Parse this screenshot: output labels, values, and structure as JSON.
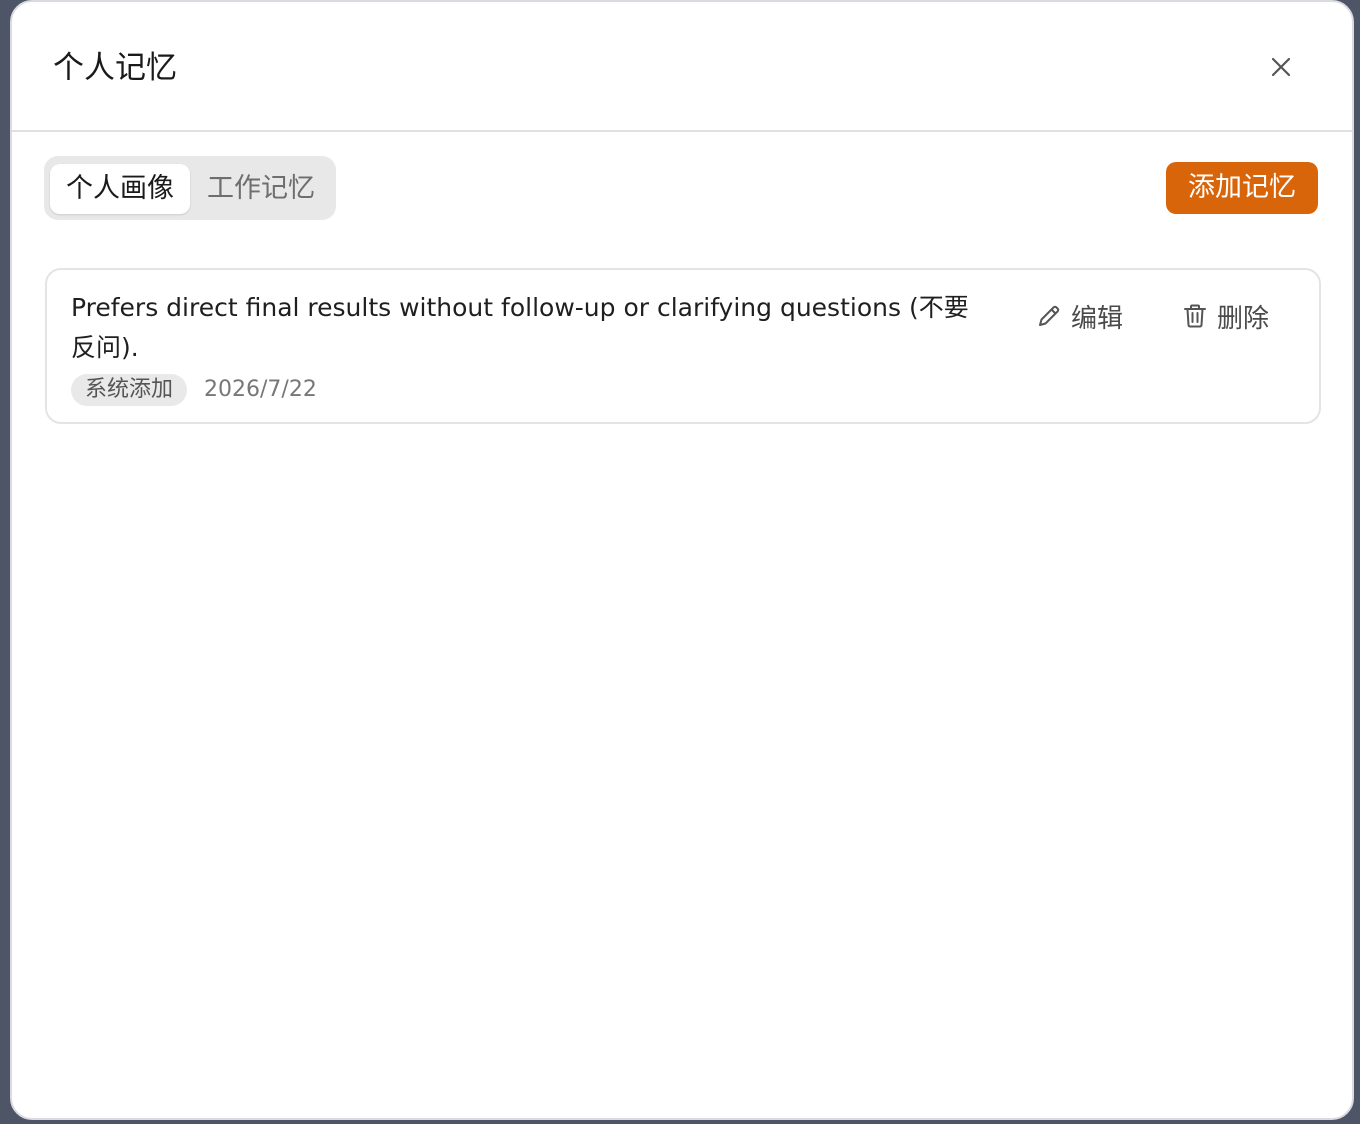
{
  "dialog": {
    "title": "个人记忆",
    "close_icon": "close-icon"
  },
  "tabs": [
    {
      "label": "个人画像",
      "active": true
    },
    {
      "label": "工作记忆",
      "active": false
    }
  ],
  "toolbar": {
    "add_label": "添加记忆"
  },
  "colors": {
    "accent": "#d9650a",
    "backdrop": "#4d5566"
  },
  "memories": [
    {
      "text": "Prefers direct final results without follow-up or clarifying questions (不要反问).",
      "source": "系统添加",
      "date": "2026/7/22",
      "edit_label": "编辑",
      "edit_icon": "pencil-icon",
      "delete_label": "删除",
      "delete_icon": "trash-icon"
    }
  ]
}
